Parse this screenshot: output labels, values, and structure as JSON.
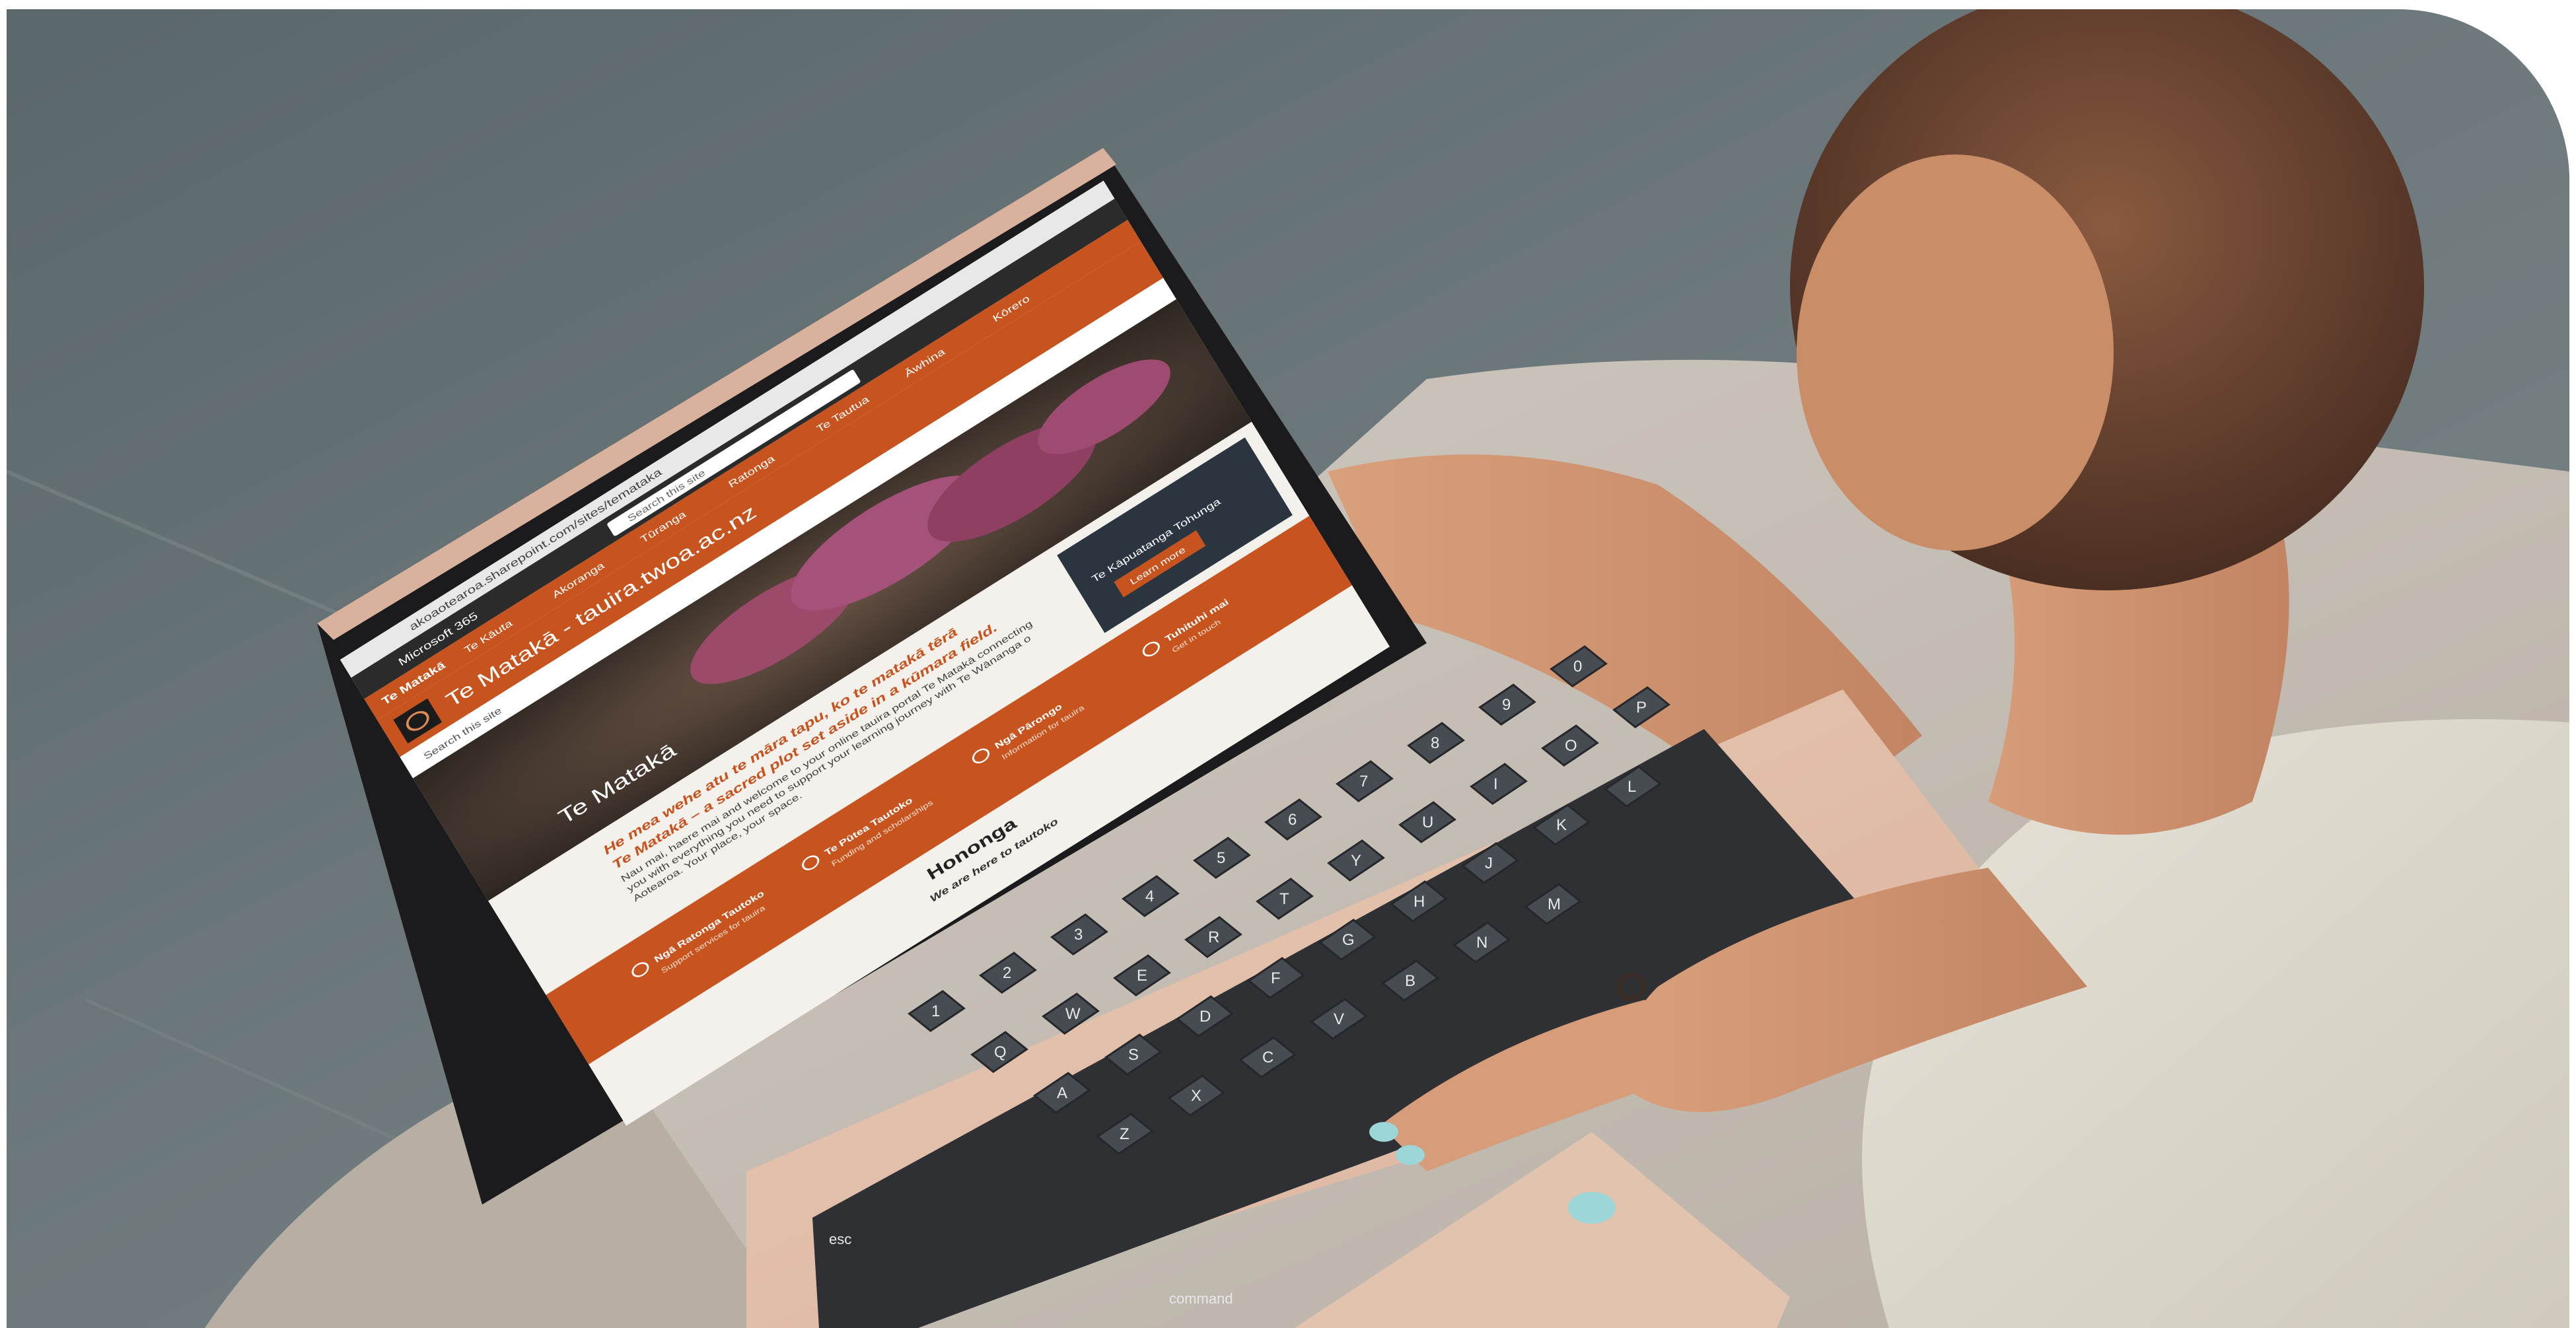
{
  "screen": {
    "url": "akoaotearoa.sharepoint.com/sites/temataka",
    "app_launcher_label": "Microsoft 365",
    "search_placeholder": "Search this site",
    "site_name": "Te Matakā",
    "site_title": "Te Matakā - tauira.twoa.ac.nz",
    "site_search_placeholder": "Search this site",
    "nav_items": [
      "Te Kāuta",
      "Akoranga",
      "Tūranga",
      "Ratonga",
      "Te Tautua",
      "Āwhina",
      "Kōrero"
    ],
    "hero_title": "Te Matakā",
    "intro_heading": "He mea wehe atu te māra tapu, ko te matakā tērā",
    "intro_subheading": "Te Matakā – a sacred plot set aside in a kūmara field.",
    "intro_body": "Nau mai, haere mai and welcome to your online tauira portal Te Matakā connecting you with everything you need to support your learning journey with Te Wānanga o Aotearoa. Your place, your space.",
    "info_cards": [
      {
        "title": "Ngā Ratonga Tautoko",
        "text": "Support services for tauira"
      },
      {
        "title": "Te Pūtea Tautoko",
        "text": "Funding and scholarships"
      },
      {
        "title": "Ngā Pārongo",
        "text": "Information for tauira"
      },
      {
        "title": "Tuhituhi mai",
        "text": "Get in touch"
      }
    ],
    "banner_title": "Te Kāpuatanga Tohunga",
    "banner_button": "Learn more",
    "section_title": "Hononga",
    "section_subtitle": "We are here to tautoko"
  },
  "keyboard": {
    "keys_row1": [
      "1",
      "2",
      "3",
      "4",
      "5",
      "6",
      "7",
      "8",
      "9",
      "0"
    ],
    "keys_row2": [
      "Q",
      "W",
      "E",
      "R",
      "T",
      "Y",
      "U",
      "I",
      "O",
      "P"
    ],
    "keys_row3": [
      "A",
      "S",
      "D",
      "F",
      "G",
      "H",
      "J",
      "K",
      "L"
    ],
    "keys_row4": [
      "Z",
      "X",
      "C",
      "V",
      "B",
      "N",
      "M"
    ],
    "key_esc": "esc",
    "key_command": "command"
  }
}
